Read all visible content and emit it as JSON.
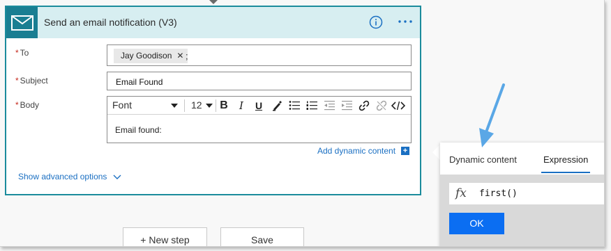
{
  "card": {
    "title": "Send an email notification (V3)",
    "icon": "mail-icon",
    "header_color": "#d7eef1",
    "accent": "#1a7e92"
  },
  "fields": {
    "to_label": "To",
    "to_token": "Jay Goodison",
    "to_separator": ";",
    "subject_label": "Subject",
    "subject_value": "Email Found",
    "body_label": "Body",
    "body_value": "Email found:",
    "required_marker": "*"
  },
  "toolbar": {
    "font": "Font",
    "size": "12",
    "bold": "B",
    "italic": "I",
    "underline": "U"
  },
  "links": {
    "add_dynamic": "Add dynamic content",
    "add_dynamic_plus": "+",
    "advanced": "Show advanced options"
  },
  "buttons": {
    "new_step": "+ New step",
    "save": "Save"
  },
  "popup": {
    "tab_dynamic": "Dynamic content",
    "tab_expression": "Expression",
    "active_tab": "Expression",
    "fx": "fx",
    "expression": "first()",
    "ok": "OK"
  },
  "colors": {
    "link": "#1a6fc2",
    "ok_button": "#0b6ef2",
    "annotation_arrow": "#5aa7e6"
  }
}
